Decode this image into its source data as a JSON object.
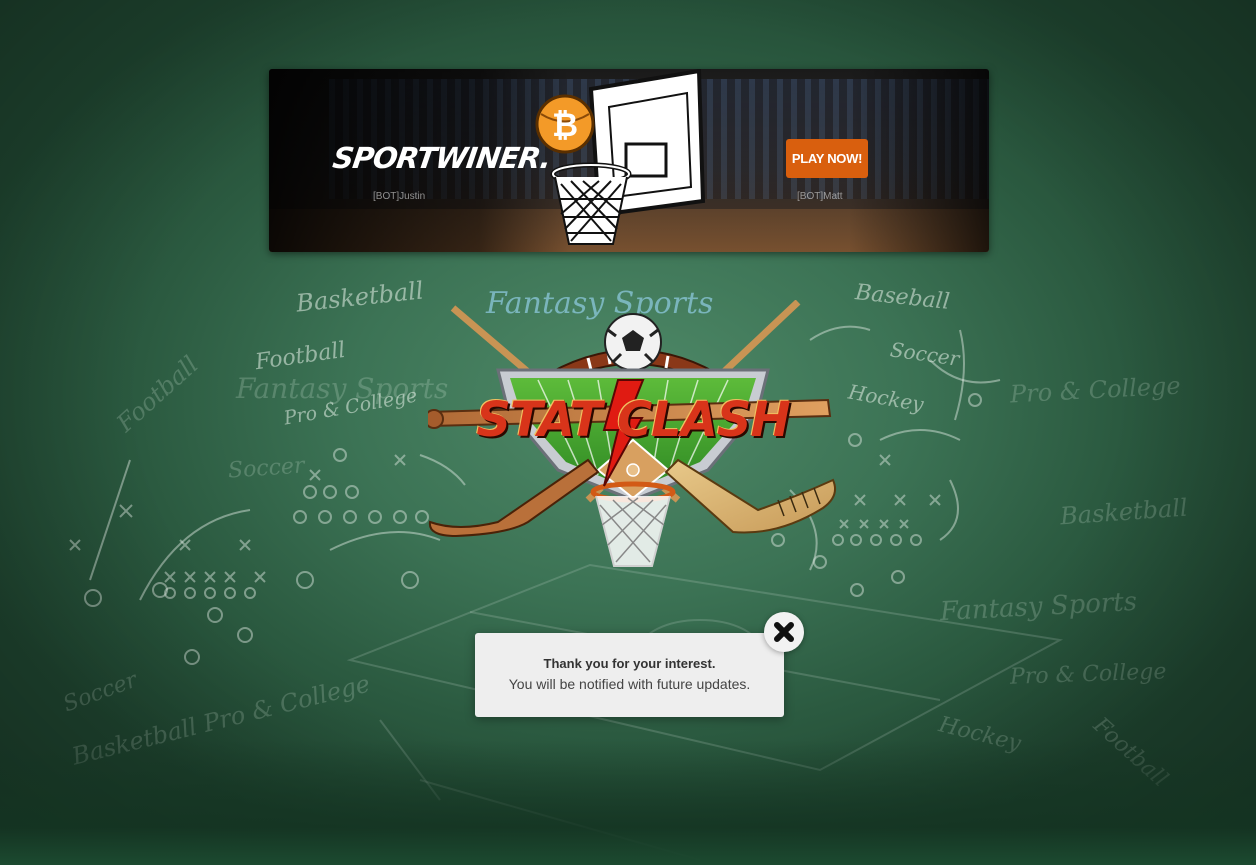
{
  "banner": {
    "brand": "SPORTWINER.",
    "cta": "PLAY NOW!",
    "player_left": "[BOT]Justin",
    "player_right": "[BOT]Matt"
  },
  "chalkboard": {
    "words": [
      "Basketball",
      "Fantasy Sports",
      "Baseball",
      "Football",
      "Soccer",
      "Fantasy Sports",
      "Pro & College",
      "Football",
      "Pro & College",
      "Hockey",
      "Soccer",
      "Basketball",
      "Fantasy Sports",
      "Pro & College",
      "Soccer",
      "Basketball Pro & College",
      "Hockey",
      "Football"
    ]
  },
  "logo": {
    "title": "STAT CLASH"
  },
  "notification": {
    "title": "Thank you for your interest.",
    "message": "You will be notified with future updates."
  },
  "colors": {
    "chalkboard_green": "#3c7355",
    "cta_orange": "#d95f0e",
    "title_red": "#d8341a",
    "toast_bg": "#eeeeee"
  }
}
